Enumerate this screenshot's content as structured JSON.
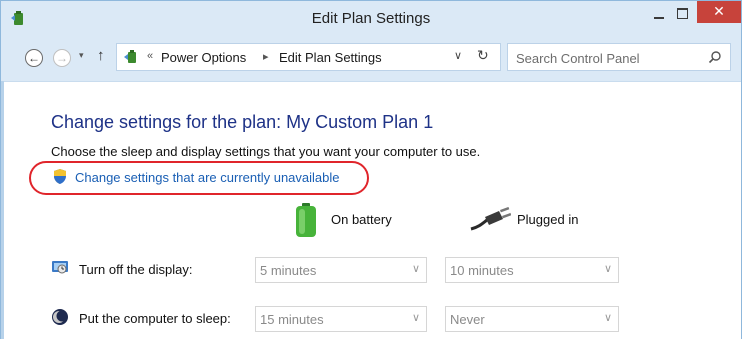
{
  "window": {
    "title": "Edit Plan Settings",
    "close_glyph": "✕"
  },
  "navbar": {
    "back_glyph": "←",
    "forward_glyph": "→",
    "recent_glyph": "▾",
    "up_glyph": "↑",
    "breadcrumbs": [
      "Power Options",
      "Edit Plan Settings"
    ],
    "overflow_glyph": "«",
    "crumb_separator": "▸",
    "dropdown_glyph": "∨",
    "refresh_glyph": "↻",
    "search_placeholder": "Search Control Panel"
  },
  "content": {
    "heading": "Change settings for the plan: My Custom Plan 1",
    "subtext": "Choose the sleep and display settings that you want your computer to use.",
    "uac_link": "Change settings that are currently unavailable",
    "columns": {
      "on_battery": "On battery",
      "plugged_in": "Plugged in"
    },
    "rows": [
      {
        "label": "Turn off the display:",
        "icon": "display-icon",
        "on_battery": "5 minutes",
        "plugged_in": "10 minutes"
      },
      {
        "label": "Put the computer to sleep:",
        "icon": "sleep-moon-icon",
        "on_battery": "15 minutes",
        "plugged_in": "Never"
      }
    ],
    "select_chevron": "∨"
  },
  "colors": {
    "titlebar": "#dbe9f6",
    "heading": "#1e3287",
    "link": "#1a5fb4",
    "highlight": "#e0252b",
    "close_button": "#c7433b"
  }
}
